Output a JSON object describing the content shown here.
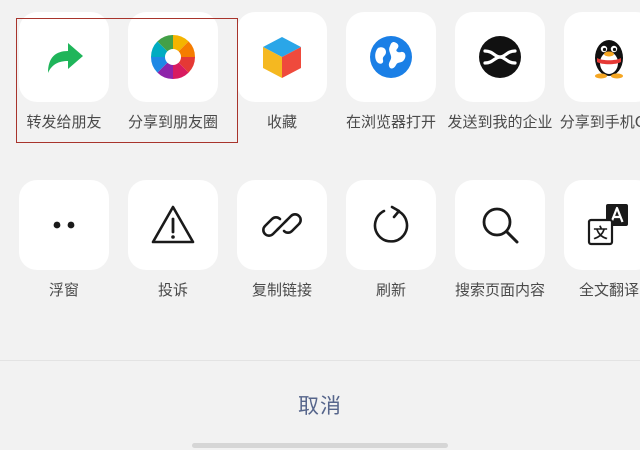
{
  "share_row": [
    {
      "label": "转发给朋友",
      "icon": "forward-arrow-icon",
      "color": "#1fb55a"
    },
    {
      "label": "分享到朋友圈",
      "icon": "moments-aperture-icon"
    },
    {
      "label": "收藏",
      "icon": "favorites-cube-icon"
    },
    {
      "label": "在浏览器打开",
      "icon": "browser-globe-icon",
      "color": "#1a7fe6"
    },
    {
      "label": "发送到我的企业",
      "icon": "wecom-icon"
    },
    {
      "label": "分享到手机QQ",
      "icon": "qq-penguin-icon"
    }
  ],
  "action_row": [
    {
      "label": "浮窗",
      "icon": "floating-window-icon"
    },
    {
      "label": "投诉",
      "icon": "warning-triangle-icon"
    },
    {
      "label": "复制链接",
      "icon": "link-icon"
    },
    {
      "label": "刷新",
      "icon": "refresh-icon"
    },
    {
      "label": "搜索页面内容",
      "icon": "search-icon"
    },
    {
      "label": "全文翻译",
      "icon": "translate-icon"
    }
  ],
  "cancel_label": "取消",
  "colors": {
    "highlight_border": "#a8342c",
    "cancel_text": "#56658b"
  }
}
